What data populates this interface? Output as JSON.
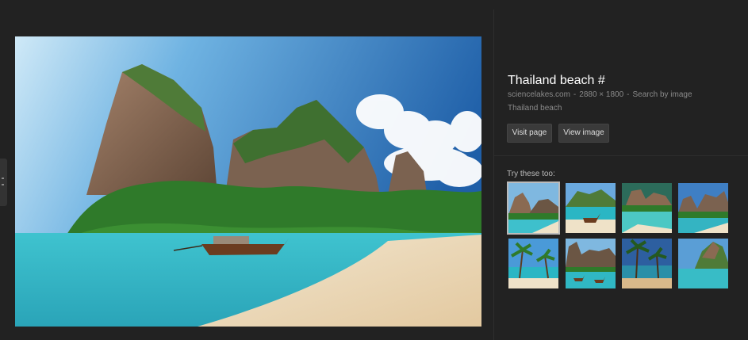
{
  "result": {
    "title": "Thailand beach #",
    "source": "sciencelakes.com",
    "separator": "-",
    "dimensions": "2880 × 1800",
    "search_by_image": "Search by image",
    "description": "Thailand beach"
  },
  "buttons": {
    "visit_page": "Visit page",
    "view_image": "View image"
  },
  "related": {
    "heading": "Try these too:",
    "thumbnails": [
      "thumb-cliff-beach",
      "thumb-longtail-boat",
      "thumb-turquoise-cove",
      "thumb-karst-shore",
      "thumb-palm-beach",
      "thumb-cliff-boats",
      "thumb-palm-sunset",
      "thumb-karst-lagoon"
    ]
  },
  "colors": {
    "background": "#222222",
    "divider": "#2e2e2e",
    "button_bg": "#3a3a3a",
    "selected_outline": "#bbbbbb"
  }
}
